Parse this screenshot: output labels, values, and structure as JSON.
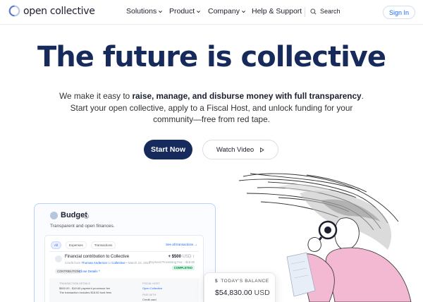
{
  "brand": {
    "name": "open collective"
  },
  "nav": {
    "items": [
      {
        "label": "Solutions",
        "has_menu": true
      },
      {
        "label": "Product",
        "has_menu": true
      },
      {
        "label": "Company",
        "has_menu": true
      },
      {
        "label": "Help & Support",
        "has_menu": false
      }
    ],
    "search_label": "Search",
    "signin_label": "Sign In"
  },
  "hero": {
    "title": "The future is collective",
    "subtitle_intro": "We make it easy to ",
    "subtitle_bold": "raise, manage, and disburse money with full transparency",
    "subtitle_rest": ". Start your open collective, apply to a Fiscal Host, and unlock funding for your community—free from red tape.",
    "start_button": "Start Now",
    "video_button": "Watch Video"
  },
  "budget_card": {
    "title": "Budget",
    "subtitle": "Transparent and open finances.",
    "tabs": [
      {
        "label": "All",
        "active": true
      },
      {
        "label": "Expenses",
        "active": false
      },
      {
        "label": "Transactions",
        "active": false
      }
    ],
    "see_all": "See all transactions →",
    "transaction": {
      "title": "Financial contribution to Collective",
      "meta_prefix": "Credit from",
      "meta_from": "Thomas Anderson",
      "meta_mid": "to",
      "meta_to": "Collective",
      "meta_date": "• March 23, 2022",
      "amount": "+ $500",
      "currency": "USD",
      "fee": "Payment Processing Fee: - $18.60",
      "status": "COMPLETED",
      "tag": "CONTRIBUTION",
      "close_label": "Close Details ^",
      "details": {
        "tx_label": "TRANSACTION DETAILS",
        "tx_line1": "$500.00 - $18.60 payment processor fee",
        "tx_line2": "The transaction includes $18.60 host fees",
        "host_label": "FISCAL HOST",
        "host_value": "Open Collective",
        "paid_label": "PAID WITH",
        "paid_value": "Credit card"
      }
    }
  },
  "balance_card": {
    "label": "TODAY'S BALANCE",
    "value": "$54,830.00",
    "currency": "USD"
  },
  "colors": {
    "brand_navy": "#162b5c",
    "link_blue": "#1869f5",
    "success_green": "#0ea55c"
  }
}
